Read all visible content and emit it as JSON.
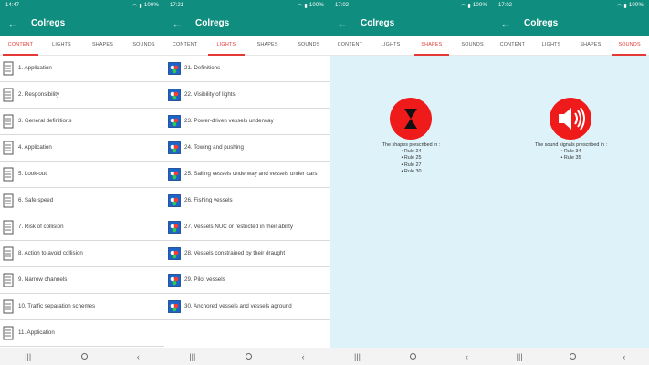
{
  "status_times": [
    "14:47",
    "17:21",
    "17:02",
    "17:02"
  ],
  "status_battery": "100%",
  "app": {
    "title": "Colregs",
    "back_glyph": "←"
  },
  "tabs": [
    "CONTENT",
    "LIGHTS",
    "SHAPES",
    "SOUNDS"
  ],
  "active_tabs": {
    "screen1": "CONTENT",
    "screen2": "LIGHTS",
    "screen3": "SHAPES",
    "screen4": "SOUNDS"
  },
  "content_items": [
    "1. Application",
    "2. Responsibility",
    "3. General definitions",
    "4. Application",
    "5. Look-out",
    "6. Safe speed",
    "7. Risk of collision",
    "8. Action to avoid collision",
    "9. Narrow channels",
    "10. Traffic separation schemes",
    "11. Application"
  ],
  "lights_items": [
    "21. Definitions",
    "22. Visibility of lights",
    "23. Power-driven vessels underway",
    "24. Towing and pushing",
    "25. Sailing vessels underway and vessels under oars",
    "26. Fishing vessels",
    "27. Vessels NUC or restricted in their ability",
    "28. Vessels constrained by their draught",
    "29. Pilot vessels",
    "30. Anchored vessels and vessels aground"
  ],
  "shapes": {
    "caption": "The shapes prescribed in :",
    "rules": [
      "• Rule 24",
      "• Rule 25",
      "• Rule 27",
      "• Rule 30"
    ],
    "icon": "hourglass-shape-icon"
  },
  "sounds": {
    "caption": "The sound signals prescribed in :",
    "rules": [
      "• Rule 34",
      "• Rule 35"
    ],
    "icon": "speaker-icon"
  },
  "navbar": {
    "recents": "|||",
    "back": "‹"
  },
  "colors": {
    "primary": "#0f8d7e",
    "accent": "#e53935",
    "panel": "#ddf3f9",
    "symbol": "#ef1b1b"
  }
}
